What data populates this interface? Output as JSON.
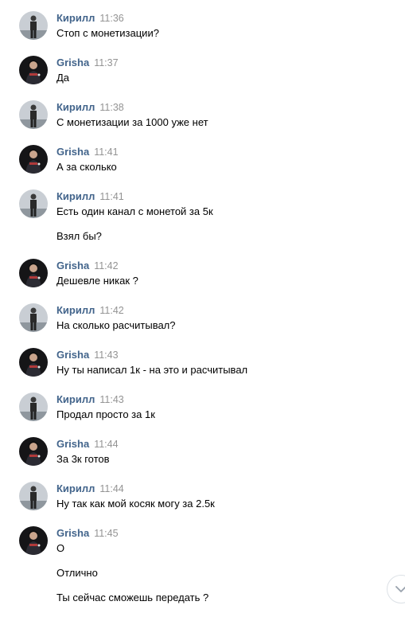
{
  "colors": {
    "author": "#42648b",
    "time": "#939393",
    "text": "#000000"
  },
  "messages": [
    {
      "author": "Кирилл",
      "time": "11:36",
      "avatar": "kirill-avatar",
      "lines": [
        "Стоп с монетизации?"
      ]
    },
    {
      "author": "Grisha",
      "time": "11:37",
      "avatar": "grisha-avatar",
      "lines": [
        "Да"
      ]
    },
    {
      "author": "Кирилл",
      "time": "11:38",
      "avatar": "kirill-avatar",
      "lines": [
        "С монетизации за 1000 уже нет"
      ]
    },
    {
      "author": "Grisha",
      "time": "11:41",
      "avatar": "grisha-avatar",
      "lines": [
        "А за сколько"
      ]
    },
    {
      "author": "Кирилл",
      "time": "11:41",
      "avatar": "kirill-avatar",
      "lines": [
        "Есть один канал с монетой за 5к",
        "Взял бы?"
      ]
    },
    {
      "author": "Grisha",
      "time": "11:42",
      "avatar": "grisha-avatar",
      "lines": [
        "Дешевле никак ?"
      ]
    },
    {
      "author": "Кирилл",
      "time": "11:42",
      "avatar": "kirill-avatar",
      "lines": [
        "На сколько расчитывал?"
      ]
    },
    {
      "author": "Grisha",
      "time": "11:43",
      "avatar": "grisha-avatar",
      "lines": [
        "Ну ты написал 1к - на это и расчитывал"
      ]
    },
    {
      "author": "Кирилл",
      "time": "11:43",
      "avatar": "kirill-avatar",
      "lines": [
        "Продал просто за 1к"
      ]
    },
    {
      "author": "Grisha",
      "time": "11:44",
      "avatar": "grisha-avatar",
      "lines": [
        "За 3к готов"
      ]
    },
    {
      "author": "Кирилл",
      "time": "11:44",
      "avatar": "kirill-avatar",
      "lines": [
        "Ну так как мой косяк могу за 2.5к"
      ]
    },
    {
      "author": "Grisha",
      "time": "11:45",
      "avatar": "grisha-avatar",
      "lines": [
        "О",
        "Отлично",
        "Ты сейчас сможешь передать ?"
      ]
    }
  ],
  "scroll_button": {
    "icon": "chevron-down-icon"
  }
}
